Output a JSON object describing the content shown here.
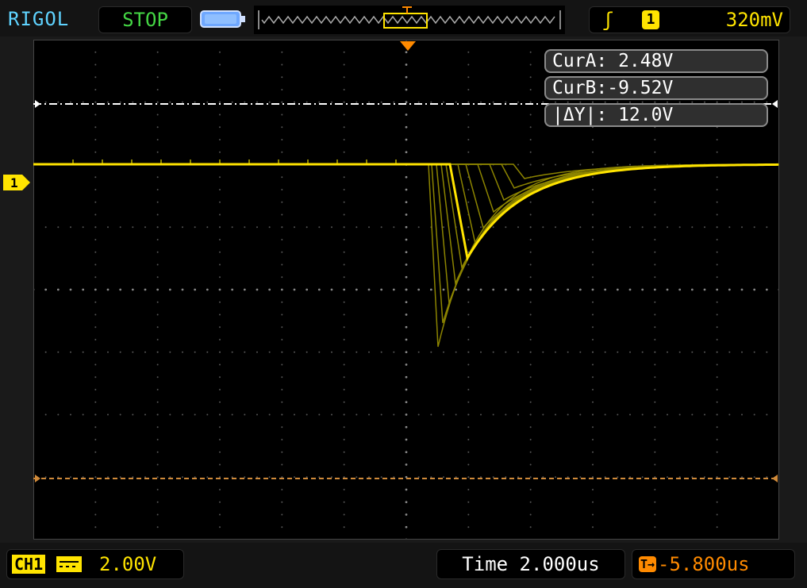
{
  "header": {
    "brand": "RIGOL",
    "run_status": "STOP",
    "trigger_source": "1",
    "trigger_level": "320mV"
  },
  "cursors": {
    "cur_a": "CurA: 2.48V",
    "cur_b": "CurB:-9.52V",
    "delta_y": "|ΔY|: 12.0V"
  },
  "channel": {
    "label": "CH1",
    "scale": "2.00V",
    "marker": "1"
  },
  "timebase": {
    "time_div": "Time 2.000us",
    "trigger_offset": "-5.800us"
  },
  "colors": {
    "channel1": "#ffe400",
    "status_stop": "#44d644",
    "brand": "#5fd3ff",
    "trigger_offset": "#ff8a00",
    "cursor_a_line": "#ffffff",
    "cursor_b_line": "#d08a3a"
  },
  "icons": {
    "memory_depth": "memory-battery-icon",
    "trigger_edge": "rising-edge-icon",
    "coupling": "dc-coupling-icon",
    "trigger_position": "trigger-position-marker-icon"
  }
}
